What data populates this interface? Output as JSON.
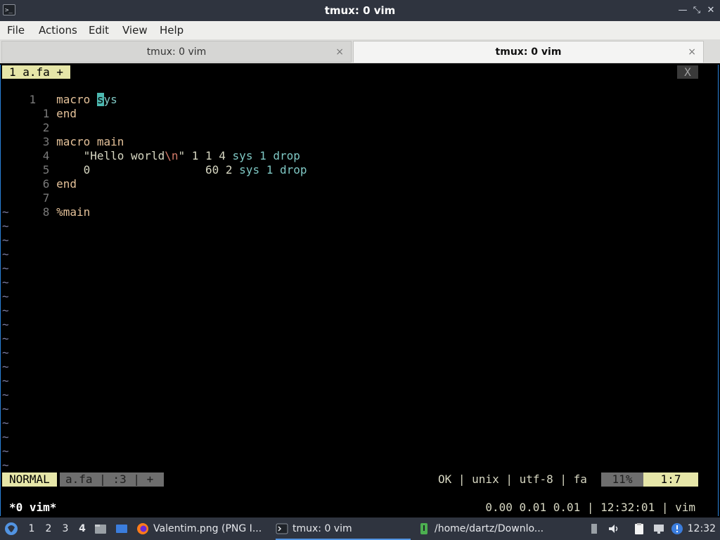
{
  "window": {
    "title": "tmux: 0 vim",
    "icon": "terminal-icon"
  },
  "menu": [
    "File",
    "Actions",
    "Edit",
    "View",
    "Help"
  ],
  "tabs": [
    {
      "label": "tmux: 0 vim",
      "close": "×"
    },
    {
      "label": "tmux: 0 vim",
      "close": "×"
    }
  ],
  "vim": {
    "tabline": {
      "active": " 1 a.fa + ",
      "close": "X"
    },
    "lines": [
      {
        "num": "1",
        "code_a": "macro ",
        "code_cursor": "s",
        "code_b": "ys"
      },
      {
        "num": "  1",
        "code": "end"
      },
      {
        "num": "  2",
        "code": ""
      },
      {
        "num": "  3",
        "code": "macro main"
      },
      {
        "num": "  4",
        "code_str": "    \"Hello world",
        "code_esc": "\\n",
        "code_str2": "\"",
        "code_num": " 1 1 4 ",
        "code_kw": "sys 1 drop"
      },
      {
        "num": "  5",
        "code_num": "    0                 60 2 ",
        "code_kw": "sys 1 drop"
      },
      {
        "num": "  6",
        "code": "end"
      },
      {
        "num": "  7",
        "code": ""
      },
      {
        "num": "  8",
        "code": "%main"
      }
    ],
    "tilde": "~",
    "status": {
      "mode": "NORMAL",
      "context": "a.fa | :3 | +",
      "right": "OK | unix | utf-8 | fa",
      "percent": "11%",
      "position": "1:7"
    }
  },
  "tmux": {
    "window": "*0 vim*",
    "right": "0.00 0.01 0.01 | 12:32:01 | vim"
  },
  "taskbar": {
    "desktops": [
      "1",
      "2",
      "3",
      "4"
    ],
    "tasks": [
      {
        "label": "Valentim.png (PNG I...",
        "icon": "firefox-icon"
      },
      {
        "label": "tmux: 0 vim",
        "icon": "terminal-icon"
      },
      {
        "label": "/home/dartz/Downlo...",
        "icon": "terminal-icon"
      }
    ],
    "clock": "12:32"
  },
  "colors": {
    "accent": "#5294e2",
    "panel": "#2f343f",
    "vim_yellow": "#e6e6a8"
  }
}
